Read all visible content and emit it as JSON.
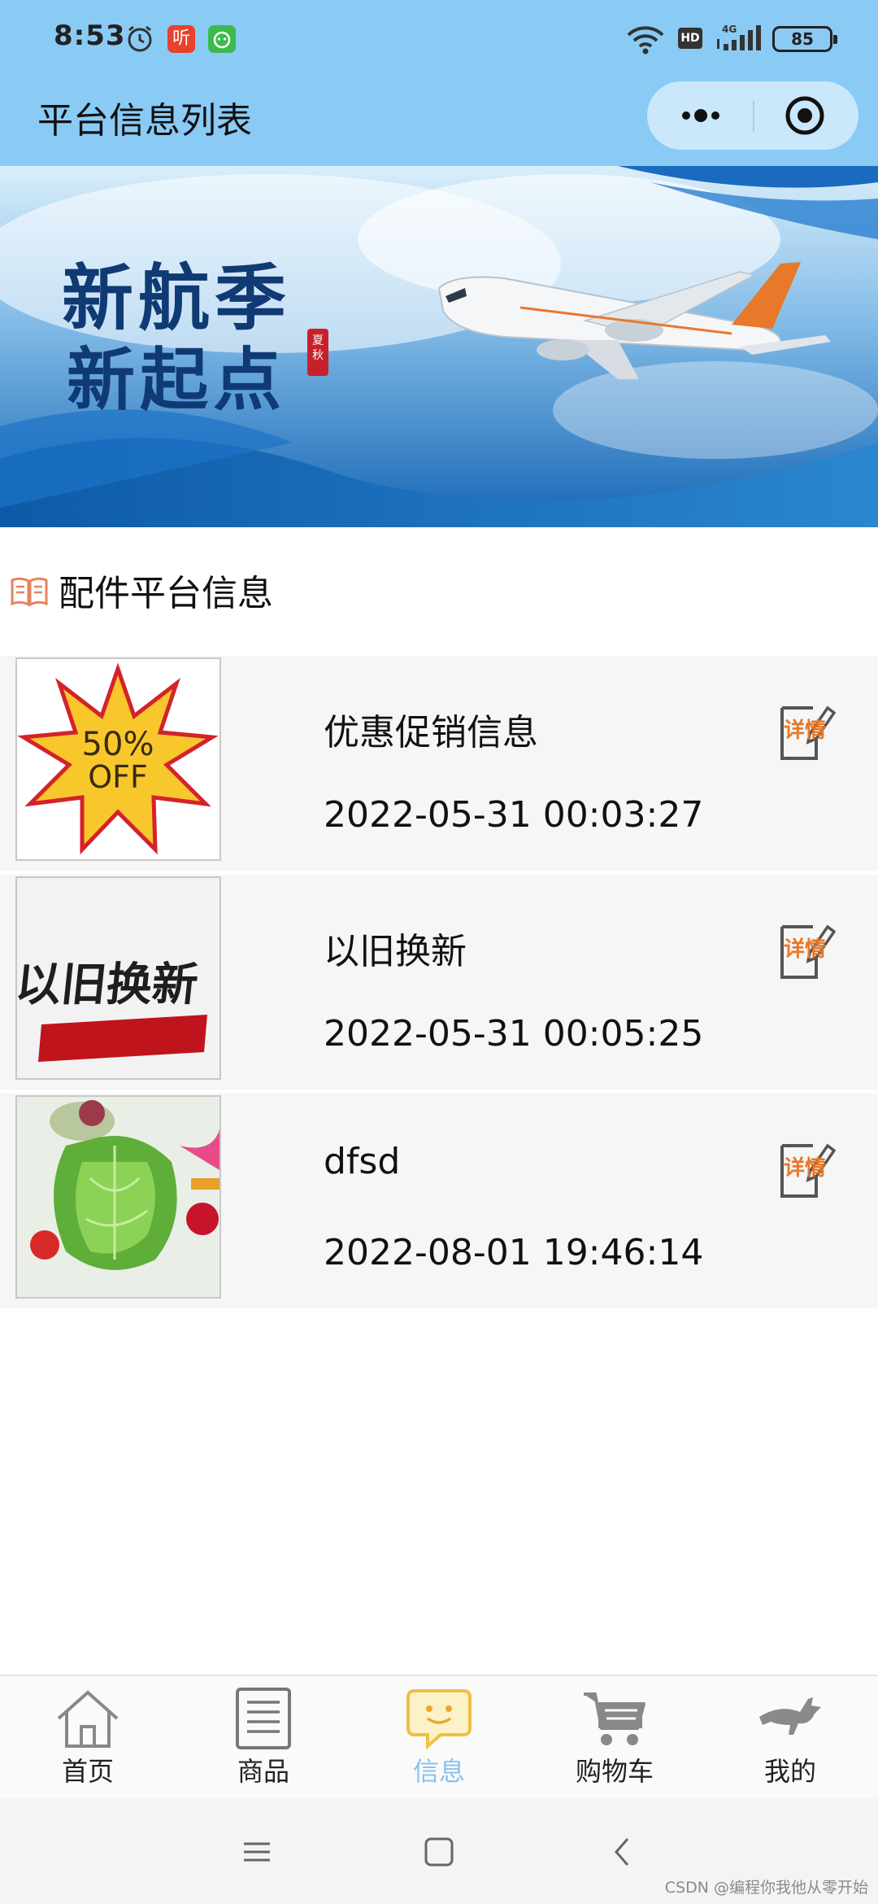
{
  "status_bar": {
    "time": "8:53",
    "app1_label": "听",
    "hd_label": "HD",
    "network_label": "4G",
    "battery": "85"
  },
  "nav": {
    "title": "平台信息列表"
  },
  "banner": {
    "line1": "新航季",
    "line2": "新起点",
    "seal": "夏秋"
  },
  "section": {
    "title": "配件平台信息",
    "icon": "book-icon"
  },
  "items": [
    {
      "title": "优惠促销信息",
      "time": "2022-05-31 00:03:27",
      "thumb_text_1": "50%",
      "thumb_text_2": "OFF"
    },
    {
      "title": "以旧换新",
      "time": "2022-05-31 00:05:25",
      "thumb_text_1": "以旧换新"
    },
    {
      "title": "dfsd",
      "time": "2022-08-01 19:46:14"
    }
  ],
  "detail_icon_text": "详情",
  "tabs": [
    {
      "label": "首页",
      "icon": "home-icon"
    },
    {
      "label": "商品",
      "icon": "list-icon"
    },
    {
      "label": "信息",
      "icon": "chat-icon",
      "active": true
    },
    {
      "label": "购物车",
      "icon": "cart-icon"
    },
    {
      "label": "我的",
      "icon": "kangaroo-icon"
    }
  ],
  "watermark": "CSDN @编程你我他从零开始",
  "colors": {
    "header_bg": "#89cbf5",
    "active_tab": "#87c3ec",
    "detail_orange": "#e8782a"
  }
}
